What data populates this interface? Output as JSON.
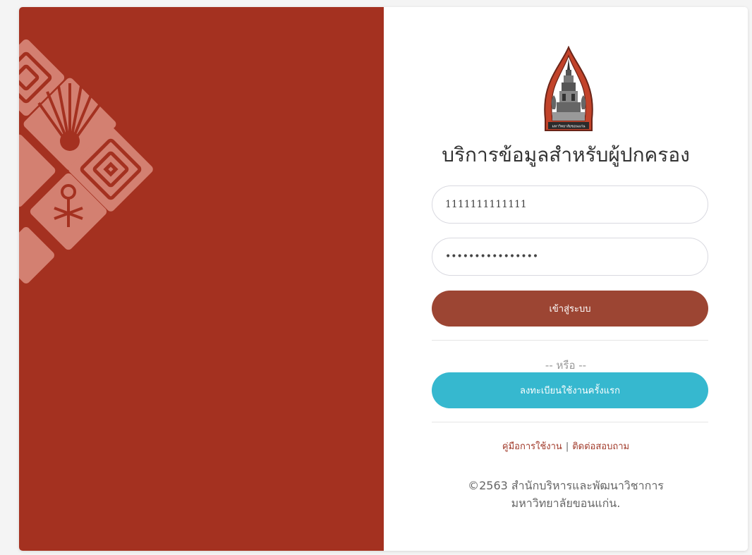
{
  "page": {
    "title": "บริการข้อมูลสำหรับผู้ปกครอง",
    "logo_caption": "มหาวิทยาลัยขอนแก่น"
  },
  "form": {
    "username_value": "1111111111111",
    "password_value": "••••••••••••••••"
  },
  "buttons": {
    "login_label": "เข้าสู่ระบบ",
    "or_text": "-- หรือ --",
    "register_label": "ลงทะเบียนใช้งานครั้งแรก"
  },
  "links": {
    "manual": "คู่มือการใช้งาน",
    "separator": "|",
    "contact": "ติดต่อสอบถาม"
  },
  "footer": {
    "line1": "©2563 สำนักบริหารและพัฒนาวิชาการ",
    "line2": "มหาวิทยาลัยขอนแก่น."
  },
  "colors": {
    "left_panel": "#a43120",
    "login_button": "#9c4533",
    "register_button": "#36b8cf",
    "link": "#a13a2a",
    "pattern": "#d9897a"
  },
  "icons": {
    "logo": "university-seal-icon",
    "pattern": "decorative-pattern"
  }
}
